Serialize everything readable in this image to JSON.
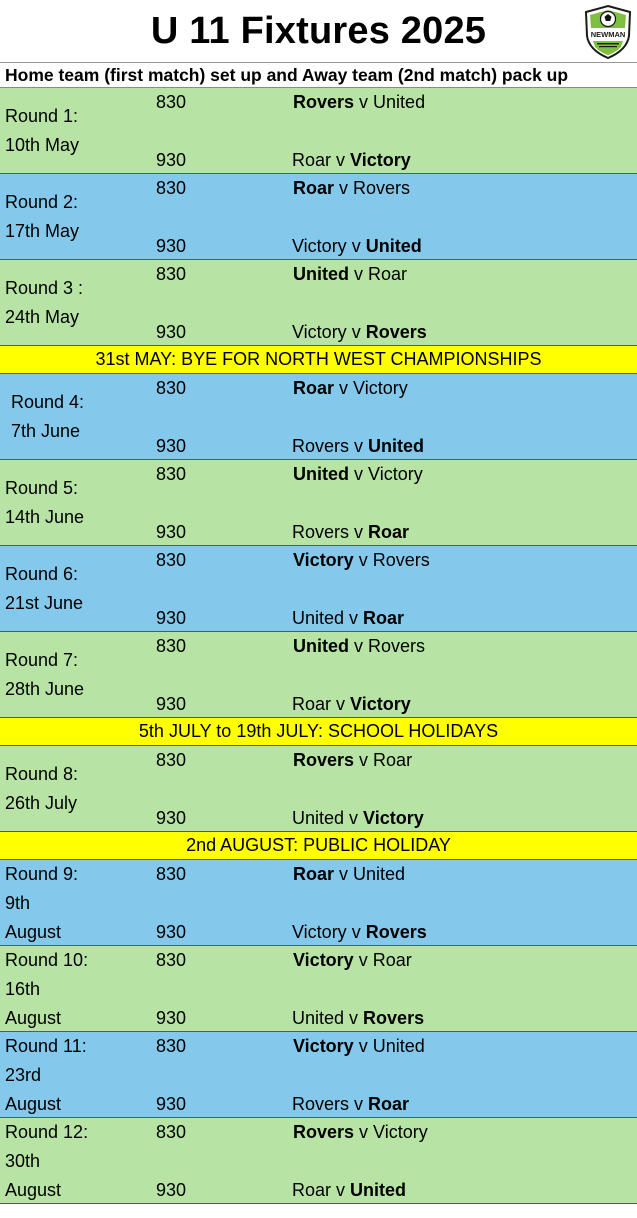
{
  "title": "U 11 Fixtures 2025",
  "logo_text": "NEWMAN",
  "subtitle": "Home team (first match) set up and Away team (2nd match) pack up",
  "rows": [
    {
      "kind": "round",
      "color": "green",
      "label": [
        "Round 1:",
        "10th May"
      ],
      "time1": "830",
      "time2": "930",
      "m1_home": "Rovers",
      "m1_sep": " v ",
      "m1_away": "United",
      "m1_bold": "home",
      "m2_home": "Roar",
      "m2_sep": " v ",
      "m2_away": "Victory",
      "m2_bold": "away"
    },
    {
      "kind": "round",
      "color": "blue",
      "label": [
        "Round 2:",
        "17th May"
      ],
      "time1": "830",
      "time2": "930",
      "m1_home": "Roar",
      "m1_sep": " v ",
      "m1_away": "Rovers",
      "m1_bold": "home",
      "m2_home": "Victory",
      "m2_sep": " v ",
      "m2_away": "United",
      "m2_bold": "away"
    },
    {
      "kind": "round",
      "color": "green",
      "label": [
        "Round 3 :",
        "24th May"
      ],
      "time1": "830",
      "time2": "930",
      "m1_home": "United",
      "m1_sep": " v ",
      "m1_away": "Roar",
      "m1_bold": "home",
      "m2_home": "Victory",
      "m2_sep": " v ",
      "m2_away": "Rovers",
      "m2_bold": "away"
    },
    {
      "kind": "bye",
      "text": "31st MAY: BYE FOR NORTH WEST CHAMPIONSHIPS"
    },
    {
      "kind": "round",
      "color": "blue",
      "indent": true,
      "label": [
        "Round 4:",
        "7th June"
      ],
      "time1": "830",
      "time2": "930",
      "m1_home": "Roar",
      "m1_sep": " v ",
      "m1_away": "Victory",
      "m1_bold": "home",
      "m2_home": "Rovers",
      "m2_sep": " v ",
      "m2_away": "United",
      "m2_bold": "away"
    },
    {
      "kind": "round",
      "color": "green",
      "label": [
        "Round 5:",
        "14th June"
      ],
      "time1": "830",
      "time2": "930",
      "m1_home": "United",
      "m1_sep": " v ",
      "m1_away": "Victory",
      "m1_bold": "home",
      "m2_home": "Rovers",
      "m2_sep": " v ",
      "m2_away": "Roar",
      "m2_bold": "away"
    },
    {
      "kind": "round",
      "color": "blue",
      "label": [
        "Round 6:",
        "21st June"
      ],
      "time1": "830",
      "time2": "930",
      "m1_home": "Victory",
      "m1_sep": " v ",
      "m1_away": "Rovers",
      "m1_bold": "home",
      "m2_home": "United",
      "m2_sep": " v ",
      "m2_away": "Roar",
      "m2_bold": "away"
    },
    {
      "kind": "round",
      "color": "green",
      "label": [
        "Round 7:",
        "28th June"
      ],
      "time1": "830",
      "time2": "930",
      "m1_home": "United",
      "m1_sep": " v ",
      "m1_away": "Rovers",
      "m1_bold": "home",
      "m2_home": "Roar",
      "m2_sep": " v ",
      "m2_away": "Victory",
      "m2_bold": "away"
    },
    {
      "kind": "bye",
      "text": "5th JULY to 19th JULY: SCHOOL HOLIDAYS"
    },
    {
      "kind": "round",
      "color": "green",
      "label": [
        "Round 8:",
        "26th July"
      ],
      "time1": "830",
      "time2": "930",
      "m1_home": "Rovers",
      "m1_sep": " v ",
      "m1_away": "Roar",
      "m1_bold": "home",
      "m2_home": "United",
      "m2_sep": " v ",
      "m2_away": "Victory",
      "m2_bold": "away"
    },
    {
      "kind": "bye",
      "text": "2nd AUGUST: PUBLIC HOLIDAY"
    },
    {
      "kind": "round",
      "color": "blue",
      "label": [
        "Round 9:",
        "9th",
        "August"
      ],
      "time1": "830",
      "time2": "930",
      "m1_home": "Roar",
      "m1_sep": " v ",
      "m1_away": "United",
      "m1_bold": "home",
      "m2_home": "Victory",
      "m2_sep": " v ",
      "m2_away": "Rovers",
      "m2_bold": "away"
    },
    {
      "kind": "round",
      "color": "green",
      "label": [
        "Round 10:",
        "16th",
        "August"
      ],
      "time1": "830",
      "time2": "930",
      "m1_home": "Victory",
      "m1_sep": " v ",
      "m1_away": "Roar",
      "m1_bold": "home",
      "m2_home": "United",
      "m2_sep": " v ",
      "m2_away": "Rovers",
      "m2_bold": "away"
    },
    {
      "kind": "round",
      "color": "blue",
      "label": [
        "Round 11:",
        "23rd",
        "August"
      ],
      "time1": "830",
      "time2": "930",
      "m1_home": "Victory",
      "m1_sep": " v ",
      "m1_away": "United",
      "m1_bold": "home",
      "m2_home": "Rovers",
      "m2_sep": " v ",
      "m2_away": "Roar",
      "m2_bold": "away"
    },
    {
      "kind": "round",
      "color": "green",
      "label": [
        "Round 12:",
        "30th",
        "August"
      ],
      "time1": "830",
      "time2": "930",
      "m1_home": "Rovers",
      "m1_sep": " v ",
      "m1_away": "Victory",
      "m1_bold": "home",
      "m2_home": "Roar",
      "m2_sep": " v ",
      "m2_away": "United",
      "m2_bold": "away"
    }
  ]
}
